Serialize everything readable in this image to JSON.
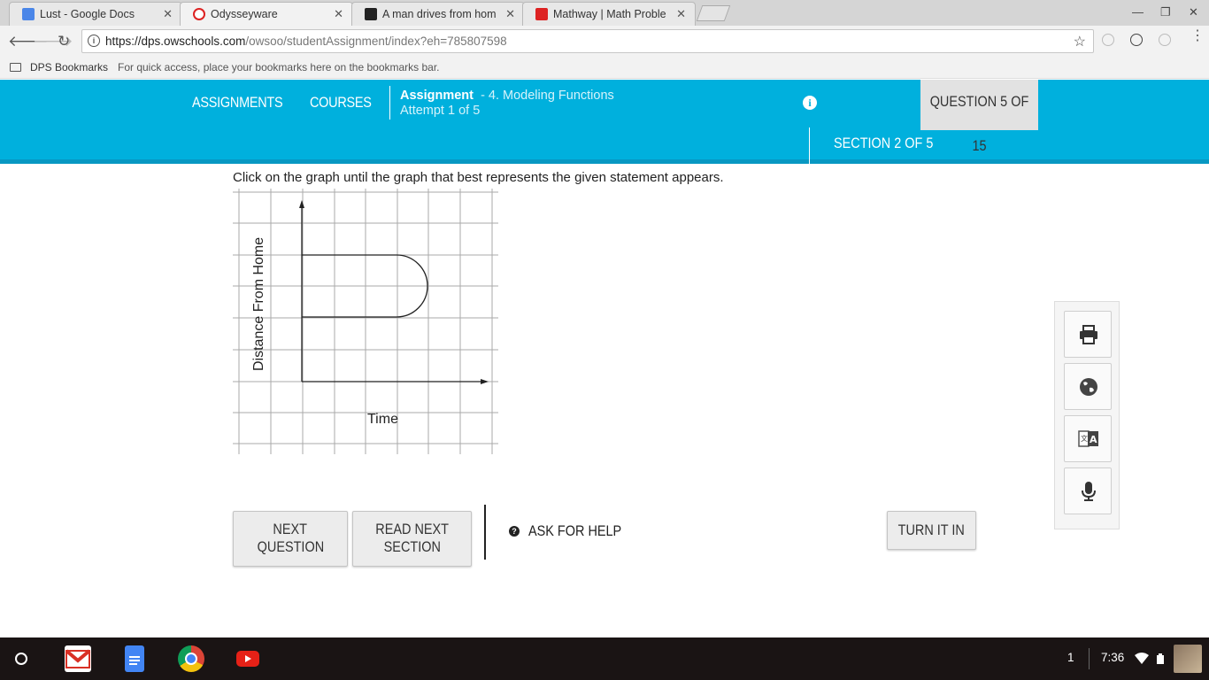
{
  "browser": {
    "tabs": [
      {
        "title": "Lust - Google Docs",
        "active": false,
        "icon": "google-docs-icon"
      },
      {
        "title": "Odysseyware",
        "active": true,
        "icon": "odysseyware-icon"
      },
      {
        "title": "A man drives from home",
        "active": false,
        "icon": "brainly-icon"
      },
      {
        "title": "Mathway | Math Problem",
        "active": false,
        "icon": "mathway-icon"
      }
    ],
    "url_host": "https://dps.owschools.com",
    "url_path": "/owsoo/studentAssignment/index?eh=785807598",
    "bookmarks_label": "DPS Bookmarks",
    "bookmarks_hint": "For quick access, place your bookmarks here on the bookmarks bar."
  },
  "header": {
    "nav_assignments": "ASSIGNMENTS",
    "nav_courses": "COURSES",
    "assignment_label": "Assignment",
    "assignment_name": "- 4. Modeling Functions",
    "attempt": "Attempt 1 of 5",
    "question_counter": "QUESTION 5 OF 15",
    "section_counter": "SECTION 2 OF 5"
  },
  "question": {
    "prompt": "Click on the graph until the graph that best represents the given statement appears.",
    "graph": {
      "ylabel": "Distance From Home",
      "xlabel": "Time"
    }
  },
  "actions": {
    "next_line1": "NEXT",
    "next_line2": "QUESTION",
    "read_line1": "READ NEXT",
    "read_line2": "SECTION",
    "help": "ASK FOR HELP",
    "turn_in": "TURN IT IN"
  },
  "tools": [
    "print-icon",
    "globe-icon",
    "translate-icon",
    "microphone-icon"
  ],
  "shelf": {
    "apps": [
      "gmail-icon",
      "google-docs-icon",
      "chrome-icon",
      "youtube-icon"
    ],
    "notification_count": "1",
    "time": "7:36"
  }
}
